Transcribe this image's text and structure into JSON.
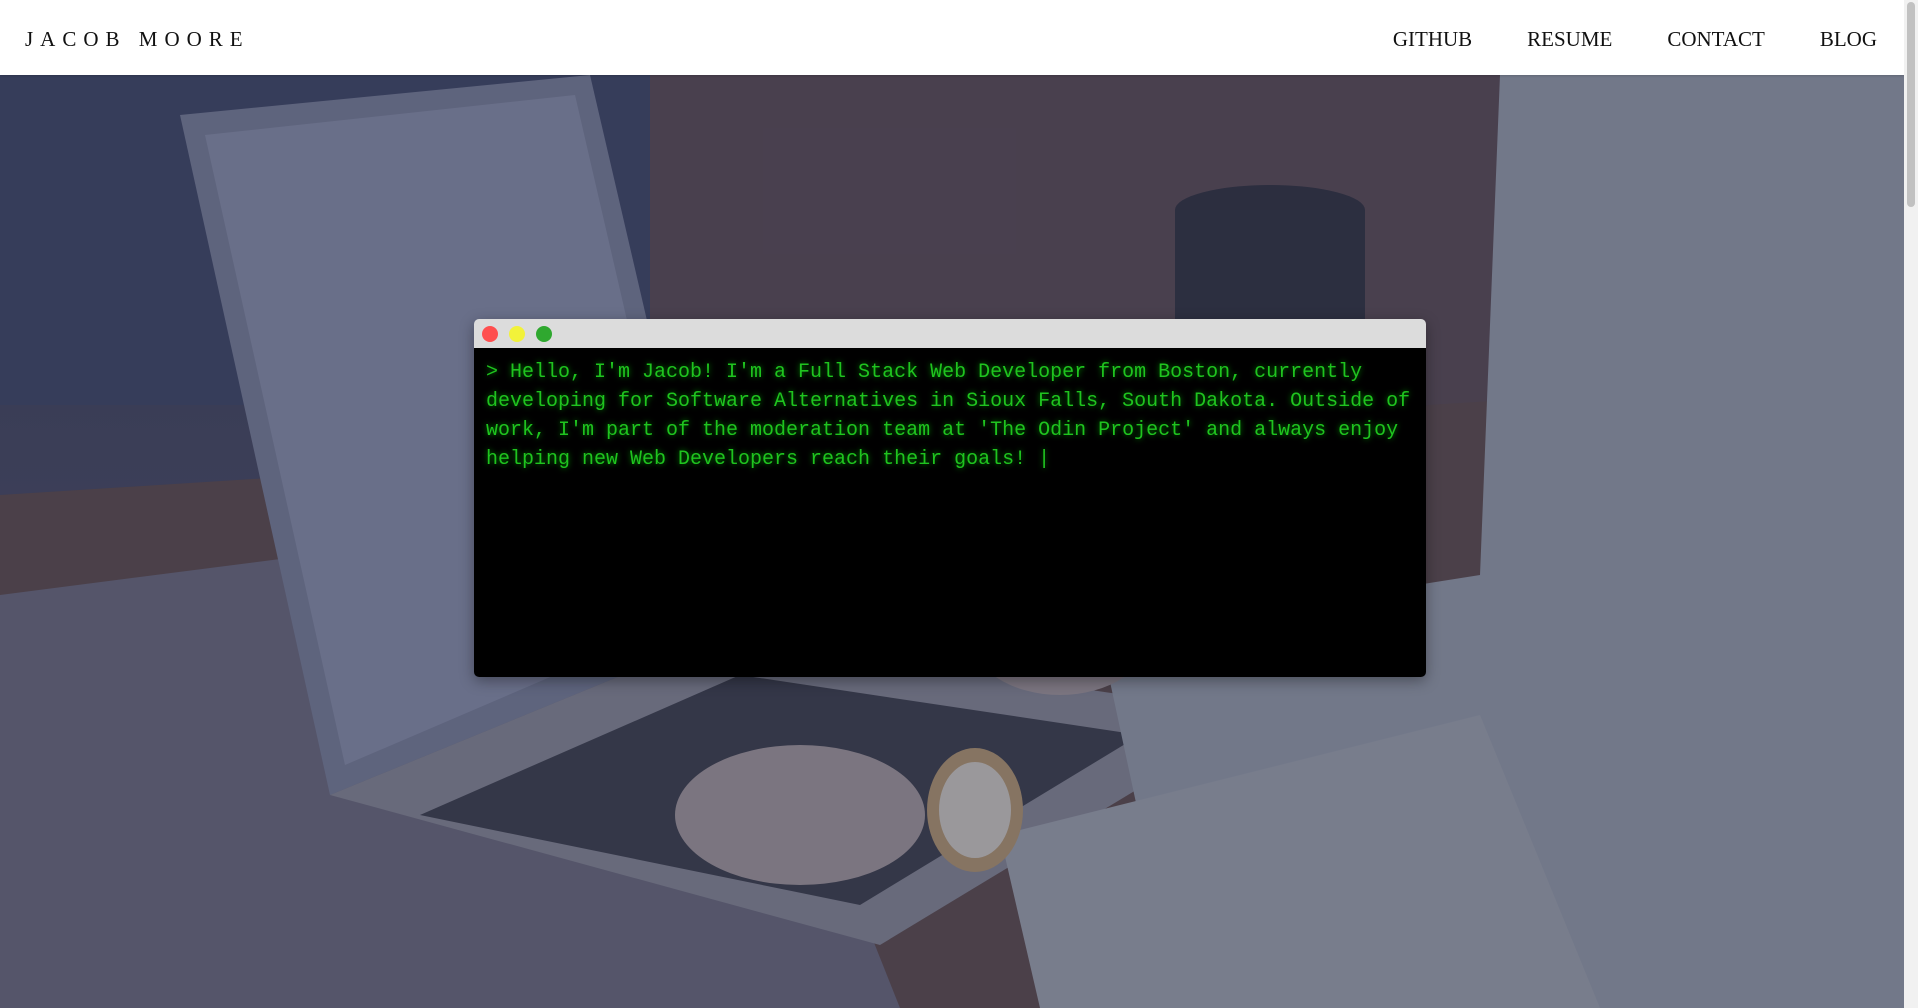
{
  "header": {
    "brand": "JACOB MOORE",
    "nav": [
      {
        "label": "GITHUB"
      },
      {
        "label": "RESUME"
      },
      {
        "label": "CONTACT"
      },
      {
        "label": "BLOG"
      }
    ]
  },
  "terminal": {
    "text": "> Hello, I'm Jacob! I'm a Full Stack Web Developer from Boston, currently developing for Software Alternatives in Sioux Falls, South Dakota. Outside of work, I'm part of the moderation team at 'The Odin Project' and always enjoy helping new Web Developers reach their goals! |",
    "text_color": "#1fc41f",
    "window_dots": [
      "red-dot-icon",
      "yellow-dot-icon",
      "green-dot-icon"
    ]
  },
  "colors": {
    "header_bg": "#ffffff",
    "terminal_bg": "#000000",
    "titlebar_bg": "#dcdcdc"
  }
}
